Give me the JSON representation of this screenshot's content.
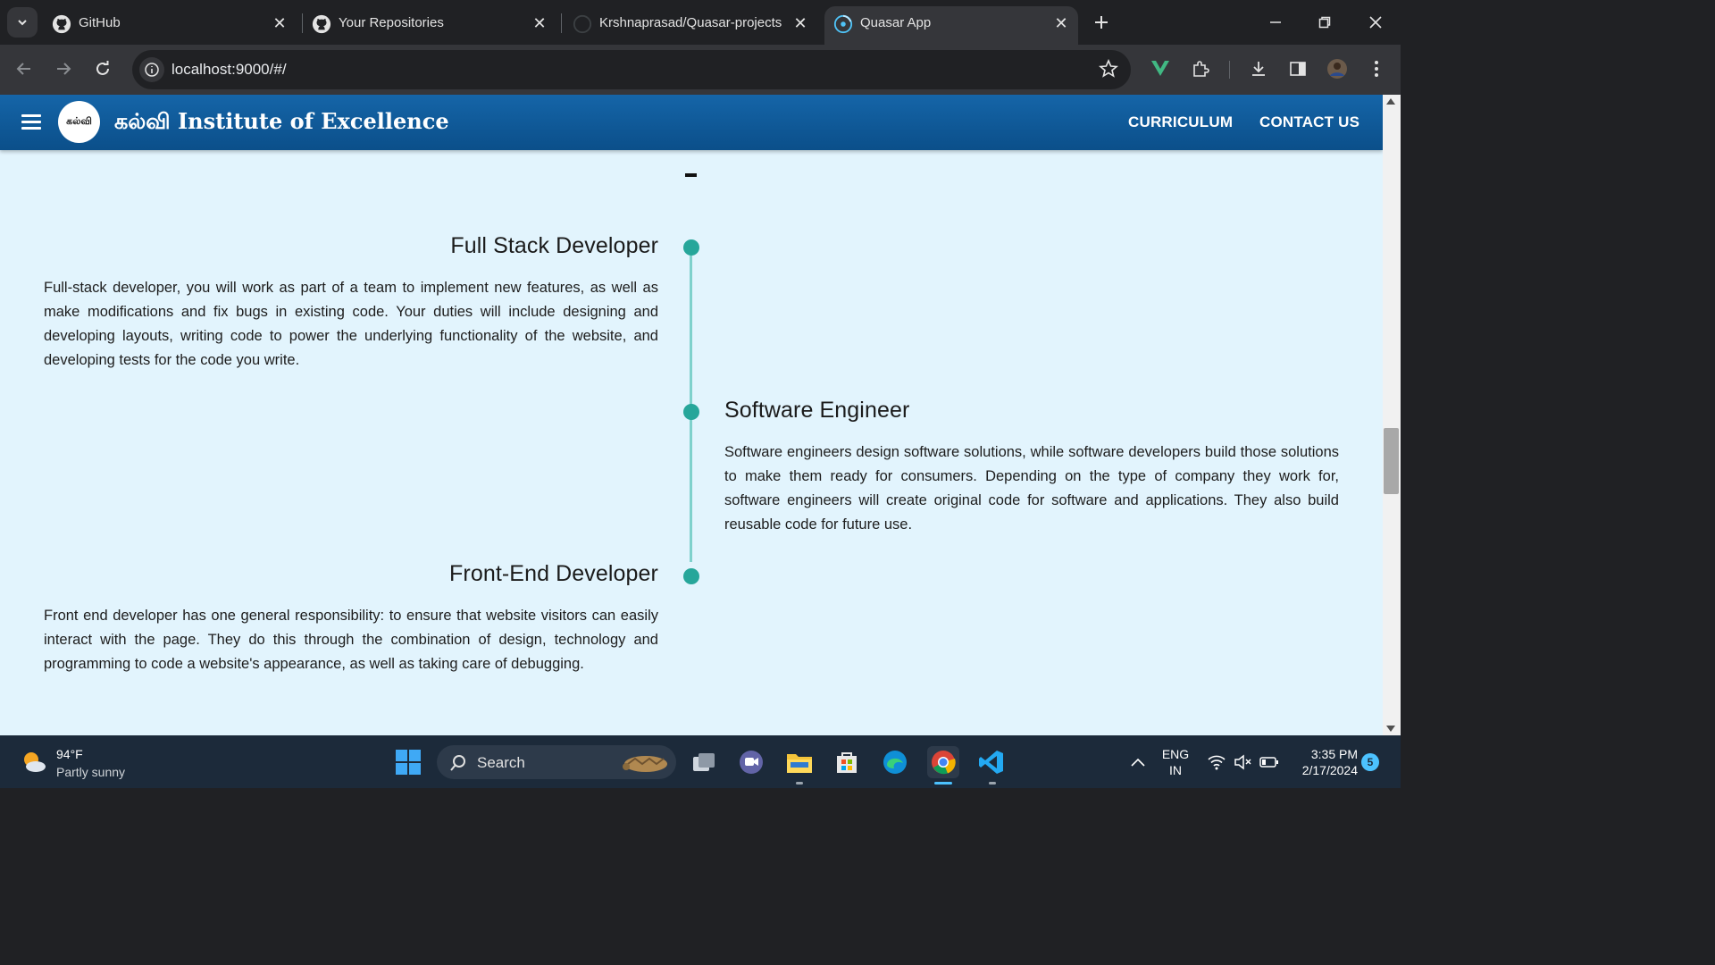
{
  "browser": {
    "tabs": [
      {
        "title": "GitHub",
        "icon": "github-icon",
        "active": false
      },
      {
        "title": "Your Repositories",
        "icon": "github-icon",
        "active": false
      },
      {
        "title": "Krshnaprasad/Quasar-projects",
        "icon": "github-icon",
        "active": false
      },
      {
        "title": "Quasar App",
        "icon": "quasar-icon",
        "active": true
      }
    ],
    "url": "localhost:9000/#/"
  },
  "app": {
    "brand_tamil": "கல்வி",
    "brand_rest": "Institute of Excellence",
    "logo_text": "கல்வி",
    "nav": {
      "curriculum": "CURRICULUM",
      "contact": "CONTACT US"
    },
    "colors": {
      "header": "#1565a8",
      "page_bg": "#e2f4fd",
      "timeline_dot": "#26a69a",
      "timeline_line": "#7fd1cc"
    }
  },
  "timeline": [
    {
      "title": "Full Stack Developer",
      "body": "Full-stack developer, you will work as part of a team to implement new features, as well as make modifications and fix bugs in existing code. Your duties will include designing and developing layouts, writing code to power the underlying functionality of the website, and developing tests for the code you write.",
      "side": "left"
    },
    {
      "title": "Software Engineer",
      "body": "Software engineers design software solutions, while software developers build those solutions to make them ready for consumers. Depending on the type of company they work for, software engineers will create original code for software and applications. They also build reusable code for future use.",
      "side": "right"
    },
    {
      "title": "Front-End Developer",
      "body": "Front end developer has one general responsibility: to ensure that website visitors can easily interact with the page. They do this through the combination of design, technology and programming to code a website's appearance, as well as taking care of debugging.",
      "side": "left"
    }
  ],
  "taskbar": {
    "weather_temp": "94°F",
    "weather_desc": "Partly sunny",
    "search_label": "Search",
    "lang_top": "ENG",
    "lang_bottom": "IN",
    "time": "3:35 PM",
    "date": "2/17/2024",
    "notification_count": "5"
  }
}
